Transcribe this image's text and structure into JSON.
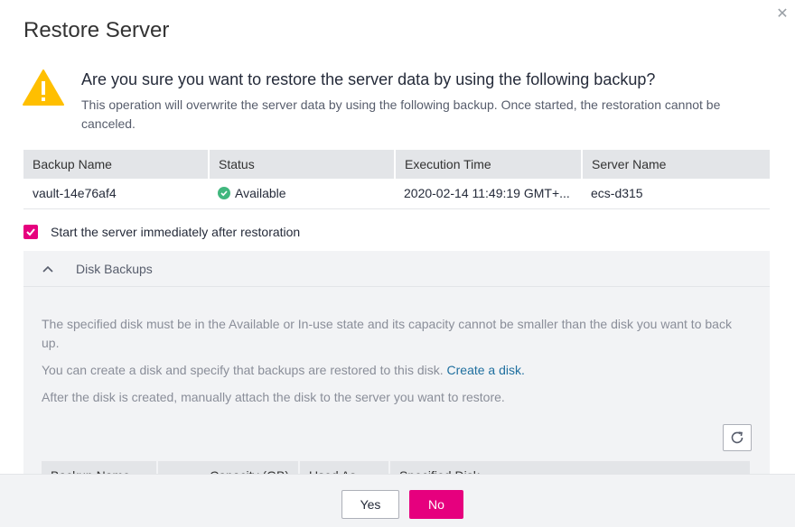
{
  "dialog": {
    "title": "Restore Server",
    "close_icon": "close-icon"
  },
  "warning": {
    "icon": "warning-icon",
    "question": "Are you sure you want to restore the server data by using the following backup?",
    "description": "This operation will overwrite the server data by using the following backup. Once started, the restoration cannot be canceled."
  },
  "backup_table": {
    "headers": [
      "Backup Name",
      "Status",
      "Execution Time",
      "Server Name"
    ],
    "rows": [
      {
        "backup_name": "vault-14e76af4",
        "status": "Available",
        "execution_time": "2020-02-14 11:49:19 GMT+...",
        "server_name": "ecs-d315"
      }
    ]
  },
  "start_option": {
    "checked": true,
    "label": "Start the server immediately after restoration"
  },
  "disk_backups": {
    "title": "Disk Backups",
    "expanded": true,
    "note1": "The specified disk must be in the Available or In-use state and its capacity cannot be smaller than the disk you want to back up.",
    "note2_prefix": "You can create a disk and specify that backups are restored to this disk.",
    "note2_link": "Create a disk.",
    "note3": "After the disk is created, manually attach the disk to the server you want to restore.",
    "refresh_icon": "refresh-icon",
    "table_headers": [
      "Backup Name",
      "Capacity (GB)",
      "Used As",
      "Specified Disk"
    ]
  },
  "footer": {
    "yes_label": "Yes",
    "no_label": "No"
  },
  "colors": {
    "accent": "#e6007e",
    "available": "#41b77e",
    "warning": "#ffbf00",
    "link": "#1f6f9f"
  }
}
